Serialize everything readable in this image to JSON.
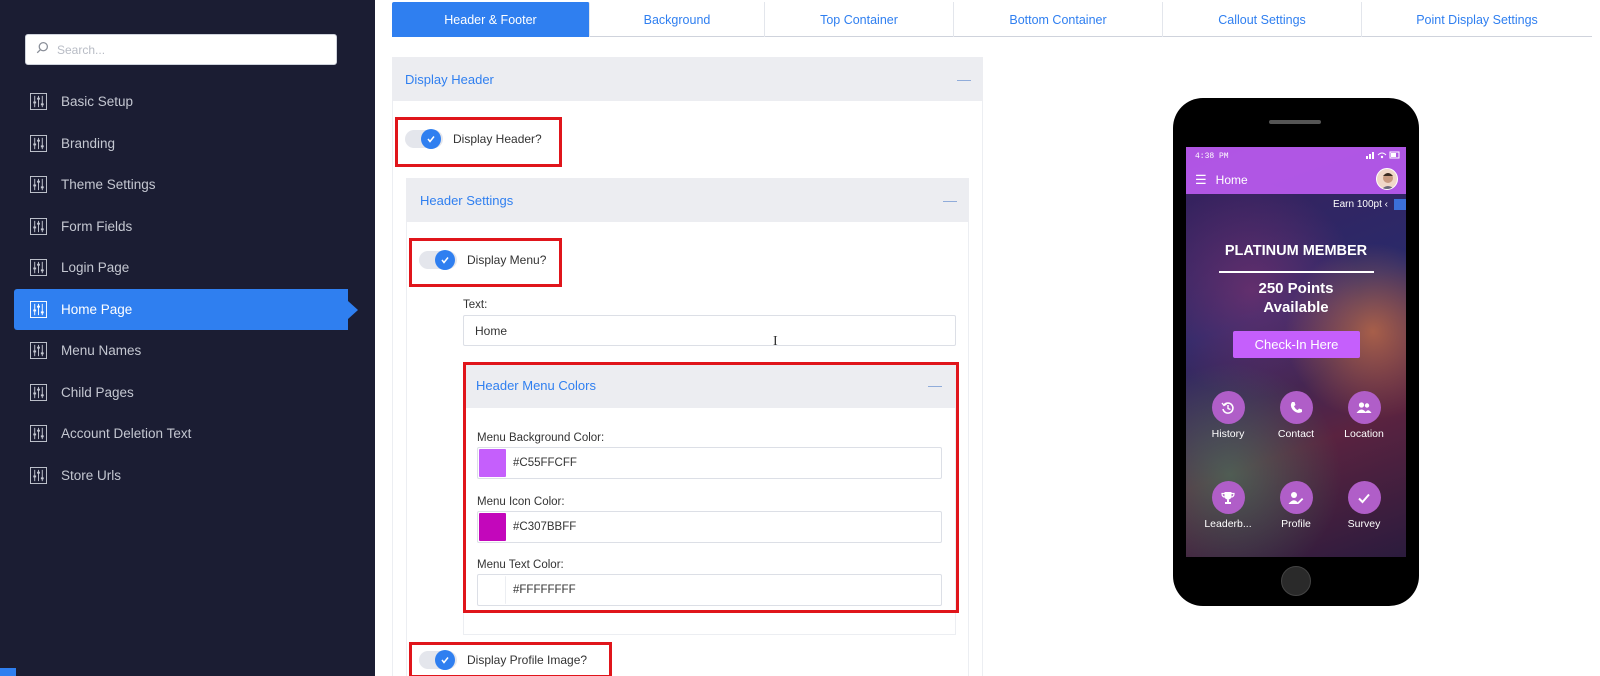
{
  "sidebar": {
    "search_placeholder": "Search...",
    "items": [
      {
        "label": "Basic Setup",
        "active": false
      },
      {
        "label": "Branding",
        "active": false
      },
      {
        "label": "Theme Settings",
        "active": false
      },
      {
        "label": "Form Fields",
        "active": false
      },
      {
        "label": "Login Page",
        "active": false
      },
      {
        "label": "Home Page",
        "active": true
      },
      {
        "label": "Menu Names",
        "active": false
      },
      {
        "label": "Child Pages",
        "active": false
      },
      {
        "label": "Account Deletion Text",
        "active": false
      },
      {
        "label": "Store Urls",
        "active": false
      }
    ],
    "icon": "sliders-icon"
  },
  "tabs": [
    {
      "label": "Header & Footer",
      "active": true
    },
    {
      "label": "Background",
      "active": false
    },
    {
      "label": "Top Container",
      "active": false
    },
    {
      "label": "Bottom Container",
      "active": false
    },
    {
      "label": "Callout Settings",
      "active": false
    },
    {
      "label": "Point Display Settings",
      "active": false
    }
  ],
  "display_header": {
    "panel_title": "Display Header",
    "toggle_label": "Display Header?",
    "enabled": true
  },
  "header_settings": {
    "panel_title": "Header Settings",
    "display_menu_label": "Display Menu?",
    "display_menu_enabled": true,
    "text_label": "Text:",
    "text_value": "Home",
    "display_profile_label": "Display Profile Image?",
    "display_profile_enabled": true
  },
  "header_menu_colors": {
    "panel_title": "Header Menu Colors",
    "bg_label": "Menu Background Color:",
    "bg_value": "#C55FFCFF",
    "bg_swatch": "#c55ffc",
    "icon_label": "Menu Icon Color:",
    "icon_value": "#C307BBFF",
    "icon_swatch": "#c307bb",
    "text_label": "Menu Text Color:",
    "text_value": "#FFFFFFFF",
    "text_swatch": "#ffffff"
  },
  "collapse_symbol": "—",
  "preview": {
    "time": "4:38 PM",
    "menu_title": "Home",
    "earn": "Earn 100pt ‹",
    "member": "PLATINUM MEMBER",
    "points_line1": "250 Points",
    "points_line2": "Available",
    "checkin": "Check-In Here",
    "icons": [
      {
        "label": "History",
        "icon": "history-icon"
      },
      {
        "label": "Contact",
        "icon": "phone-icon"
      },
      {
        "label": "Location",
        "icon": "users-icon"
      },
      {
        "label": "Leaderb...",
        "icon": "trophy-icon"
      },
      {
        "label": "Profile",
        "icon": "user-edit-icon"
      },
      {
        "label": "Survey",
        "icon": "check-icon"
      }
    ]
  },
  "colors": {
    "accent": "#2f7ff0",
    "sidebar_bg": "#1b1d33",
    "highlight": "#e0151b"
  }
}
